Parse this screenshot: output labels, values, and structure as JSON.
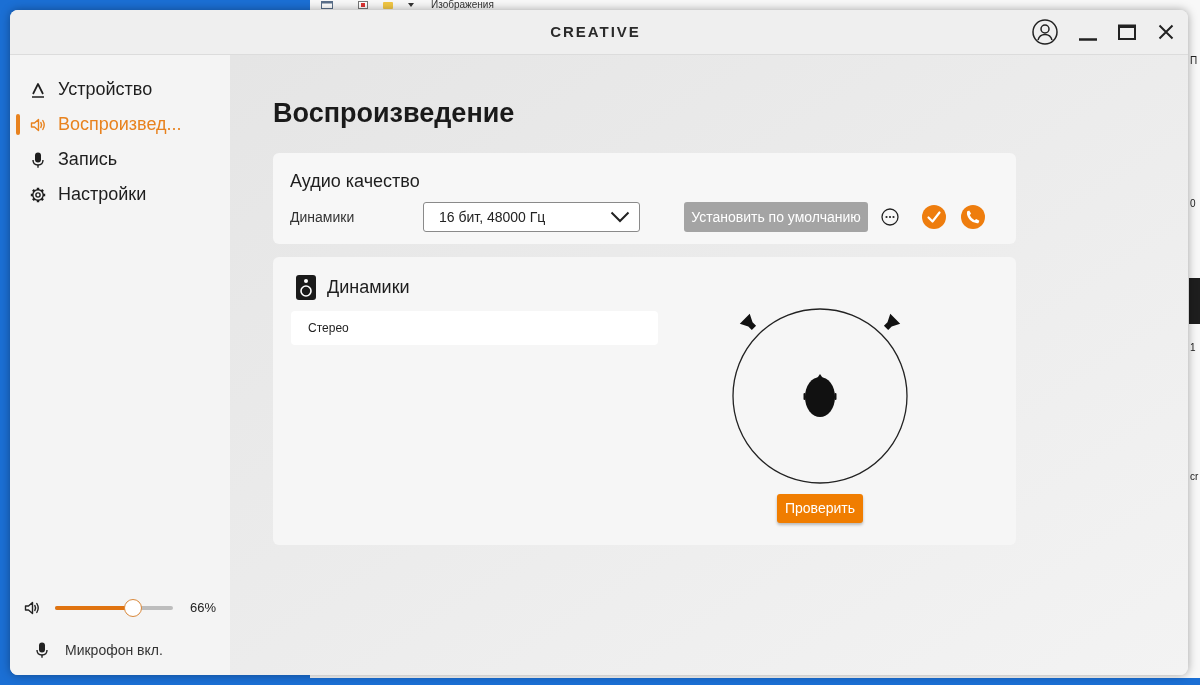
{
  "desktop": {
    "background_window": {
      "title": "Изображения",
      "edge_fragments": [
        "П",
        "0",
        "1",
        "cr"
      ]
    }
  },
  "window": {
    "logo": "CREATIVE"
  },
  "sidebar": {
    "items": [
      {
        "kind": "device",
        "label": "Устройство",
        "selected": false
      },
      {
        "kind": "playback",
        "label": "Воспроизвед...",
        "selected": true
      },
      {
        "kind": "recording",
        "label": "Запись",
        "selected": false
      },
      {
        "kind": "settings",
        "label": "Настройки",
        "selected": false
      }
    ],
    "volume": {
      "level": 0.66,
      "reading": "66%"
    },
    "microphone": {
      "label": "Микрофон вкл."
    }
  },
  "page": {
    "title": "Воспроизведение"
  },
  "audio_quality": {
    "title": "Аудио качество",
    "device_label": "Динамики",
    "format": "16 бит, 48000 Гц",
    "default_button": {
      "label": "Установить по умолчанию",
      "disabled": true
    }
  },
  "speakers": {
    "title": "Динамики",
    "configurations": [
      {
        "label": "Стерео",
        "selected": true
      }
    ],
    "test_button": "Проверить"
  }
}
